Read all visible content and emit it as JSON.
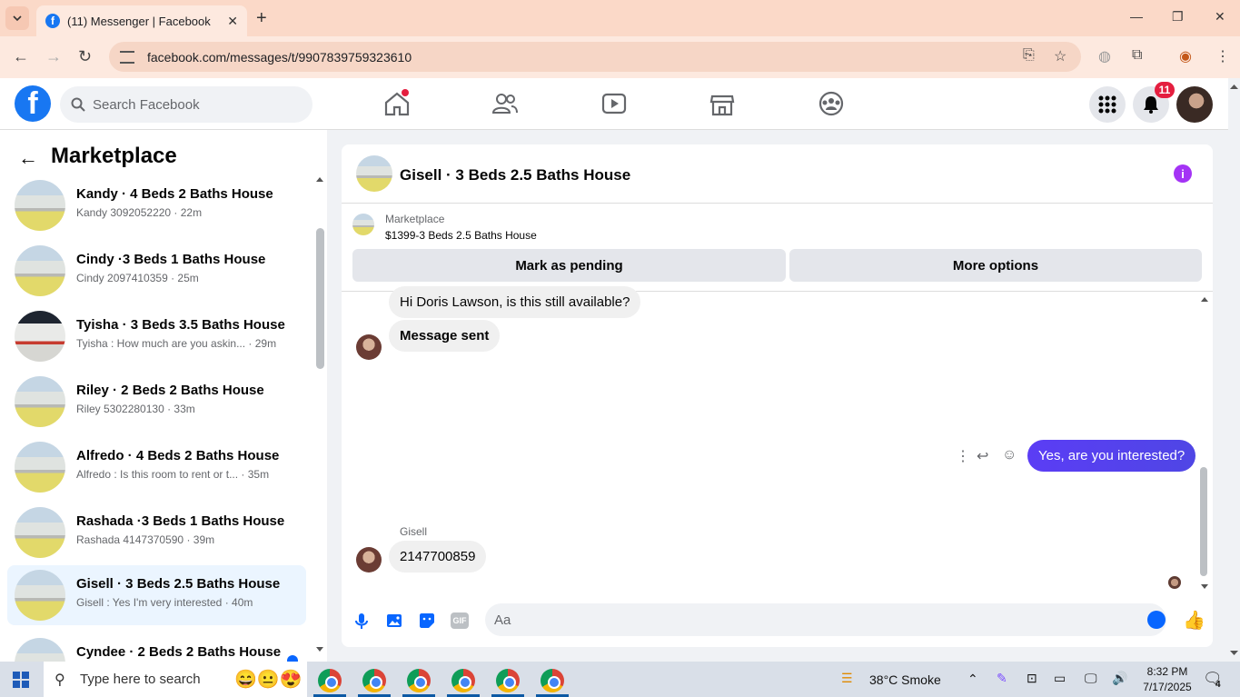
{
  "browser": {
    "tab_title": "(11) Messenger | Facebook",
    "url": "facebook.com/messages/t/9907839759323610"
  },
  "header": {
    "search_placeholder": "Search Facebook",
    "notification_count": "11"
  },
  "sidebar": {
    "title": "Marketplace",
    "conversations": [
      {
        "name": "Kandy · 4 Beds 2 Baths House",
        "snippet": "Kandy 3092052220 · 22m"
      },
      {
        "name": "Cindy ·3 Beds 1 Baths House",
        "snippet": "Cindy 2097410359 · 25m"
      },
      {
        "name": "Tyisha · 3 Beds 3.5 Baths House",
        "snippet": "Tyisha : How much are you askin... · 29m"
      },
      {
        "name": "Riley · 2 Beds 2 Baths House",
        "snippet": "Riley 5302280130 · 33m"
      },
      {
        "name": "Alfredo · 4 Beds 2 Baths House",
        "snippet": "Alfredo : Is this room to rent or t... · 35m"
      },
      {
        "name": "Rashada ·3 Beds 1 Baths House",
        "snippet": "Rashada 4147370590 · 39m"
      },
      {
        "name": "Gisell · 3 Beds 2.5 Baths House",
        "snippet": "Gisell : Yes I'm very interested · 40m"
      },
      {
        "name": "Cyndee · 2 Beds 2 Baths House",
        "snippet": ""
      }
    ]
  },
  "chat": {
    "title": "Gisell · 3 Beds 2.5 Baths House",
    "listing_source": "Marketplace",
    "listing_title": "$1399-3 Beds 2.5 Baths House",
    "btn_pending": "Mark as pending",
    "btn_more": "More options",
    "messages": {
      "m1": "Hi Doris Lawson, is this still available?",
      "m2": "Message sent",
      "m3": "Yes, are you interested?",
      "sender": "Gisell",
      "m4": "2147700859"
    },
    "composer_placeholder": "Aa",
    "gif_label": "GIF"
  },
  "taskbar": {
    "search_placeholder": "Type here to search",
    "weather": "38°C  Smoke",
    "time": "8:32 PM",
    "date": "7/17/2025",
    "notif_count": "4"
  },
  "colors": {
    "fb_blue": "#1877f2",
    "messenger_purple": "#5b3df5",
    "badge_red": "#e41e3f"
  }
}
